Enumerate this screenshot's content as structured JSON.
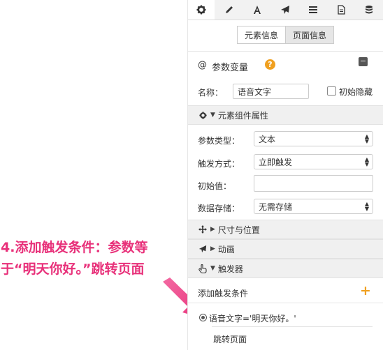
{
  "toolbar": {
    "icons": [
      "gear-icon",
      "pencil-icon",
      "text-a-icon",
      "paper-plane-icon",
      "list-icon",
      "document-icon",
      "database-icon"
    ]
  },
  "tabs": {
    "element_info": "元素信息",
    "page_info": "页面信息"
  },
  "variable": {
    "at": "@",
    "title": "参数变量",
    "help": "?",
    "collapse": "−"
  },
  "name_row": {
    "label": "名称：",
    "value": "语音文字",
    "hidden_label": "初始隐藏"
  },
  "element_props": {
    "title": "元素组件属性"
  },
  "fields": {
    "param_type": {
      "label": "参数类型：",
      "value": "文本"
    },
    "trigger_mode": {
      "label": "触发方式：",
      "value": "立即触发"
    },
    "initial_value": {
      "label": "初始值：",
      "value": ""
    },
    "storage": {
      "label": "数据存储：",
      "value": "无需存储"
    }
  },
  "sections": {
    "size_position": "尺寸与位置",
    "animation": "动画",
    "trigger": "触发器"
  },
  "trigger_list": {
    "add_label": "添加触发条件",
    "add_icon": "+",
    "condition": "语音文字='明天你好。'",
    "action": "跳转页面"
  },
  "annotation": {
    "line1": "4.添加触发条件：参数等",
    "line2": "于“明天你好。”跳转页面"
  },
  "colors": {
    "accent_orange": "#f0a020",
    "annotation_pink": "#e8317a"
  }
}
